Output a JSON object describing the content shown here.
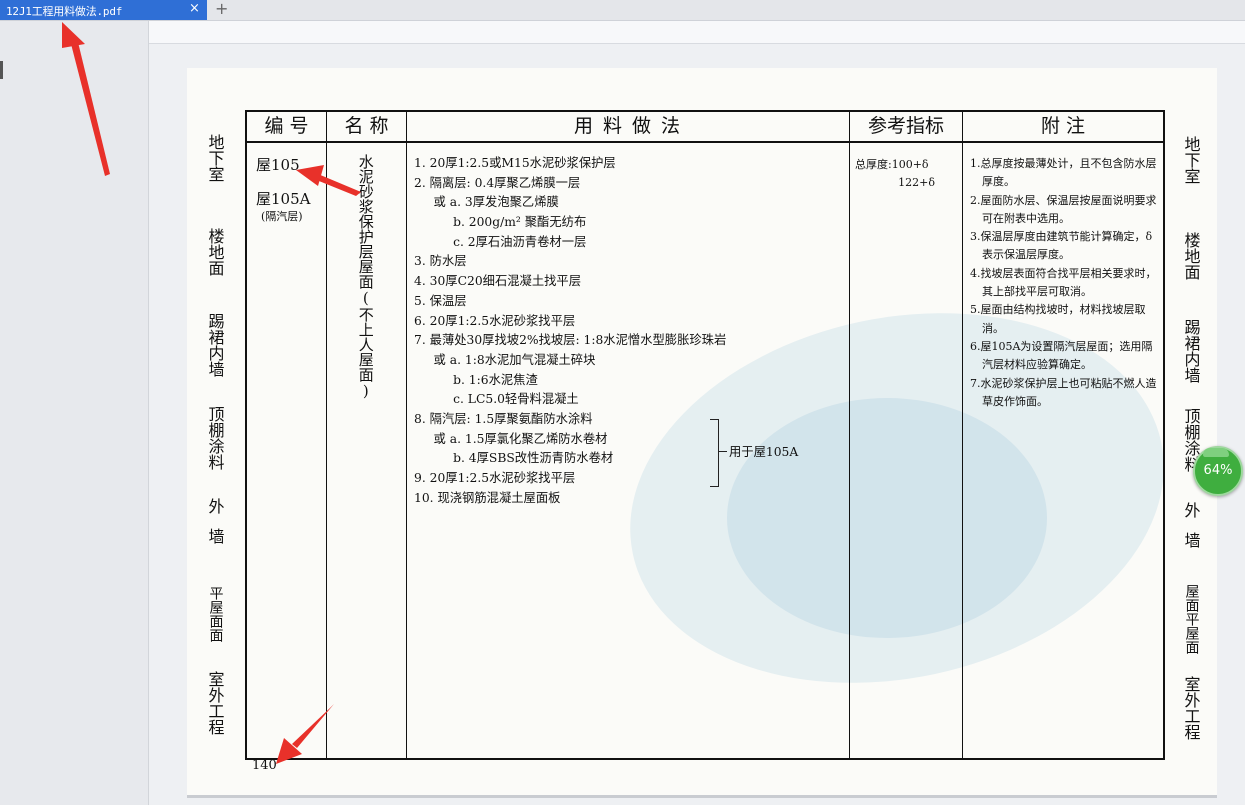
{
  "tab": {
    "title": "12J1工程用料做法.pdf",
    "close": "×",
    "add": "+"
  },
  "viewer": {
    "zoom": "64%"
  },
  "side_left": [
    "地下室",
    "楼地面",
    "踢裙内墙",
    "顶棚涂料",
    "外墙",
    "平屋面面",
    "室外工程"
  ],
  "side_right": [
    "地下室",
    "楼地面",
    "踢裙内墙",
    "顶棚涂料",
    "外墙",
    "屋面平屋面",
    "室外工程"
  ],
  "table": {
    "headers": [
      "编 号",
      "名 称",
      "用 料 做 法",
      "参考指标",
      "附 注"
    ],
    "code1": "屋105",
    "code2": "屋105A",
    "code_note": "(隔汽层)",
    "name": "水泥砂浆保护层屋面(不上人屋面)",
    "method": [
      "1. 20厚1:2.5或M15水泥砂浆保护层",
      "2. 隔离层: 0.4厚聚乙烯膜一层",
      "     或 a. 3厚发泡聚乙烯膜",
      "          b. 200g/m² 聚酯无纺布",
      "          c. 2厚石油沥青卷材一层",
      "3. 防水层",
      "4. 30厚C20细石混凝土找平层",
      "5. 保温层",
      "6. 20厚1:2.5水泥砂浆找平层",
      "7. 最薄处30厚找坡2%找坡层: 1:8水泥憎水型膨胀珍珠岩",
      "     或 a. 1:8水泥加气混凝土碎块",
      "          b. 1:6水泥焦渣",
      "          c. LC5.0轻骨料混凝土",
      "8. 隔汽层: 1.5厚聚氨酯防水涂料",
      "     或 a. 1.5厚氯化聚乙烯防水卷材",
      "          b. 4厚SBS改性沥青防水卷材",
      "9. 20厚1:2.5水泥砂浆找平层",
      "10. 现浇钢筋混凝土屋面板"
    ],
    "bracket_label": "用于屋105A",
    "ref_line1": "总厚度:100+δ",
    "ref_line2": "122+δ",
    "notes": [
      "1.总厚度按最薄处计，且不包含防水层厚度。",
      "2.屋面防水层、保温层按屋面说明要求可在附表中选用。",
      "3.保温层厚度由建筑节能计算确定，δ表示保温层厚度。",
      "4.找坡层表面符合找平层相关要求时，其上部找平层可取消。",
      "5.屋面由结构找坡时，材料找坡层取消。",
      "6.屋105A为设置隔汽层屋面；选用隔汽层材料应验算确定。",
      "7.水泥砂浆保护层上也可粘贴不燃人造草皮作饰面。"
    ]
  },
  "page_number": "140",
  "colors": {
    "tab_blue": "#2f6fd6",
    "arrow_red": "#e8312a",
    "zoom_green": "#3fae3f",
    "side_shade": "#cfcfcc"
  }
}
